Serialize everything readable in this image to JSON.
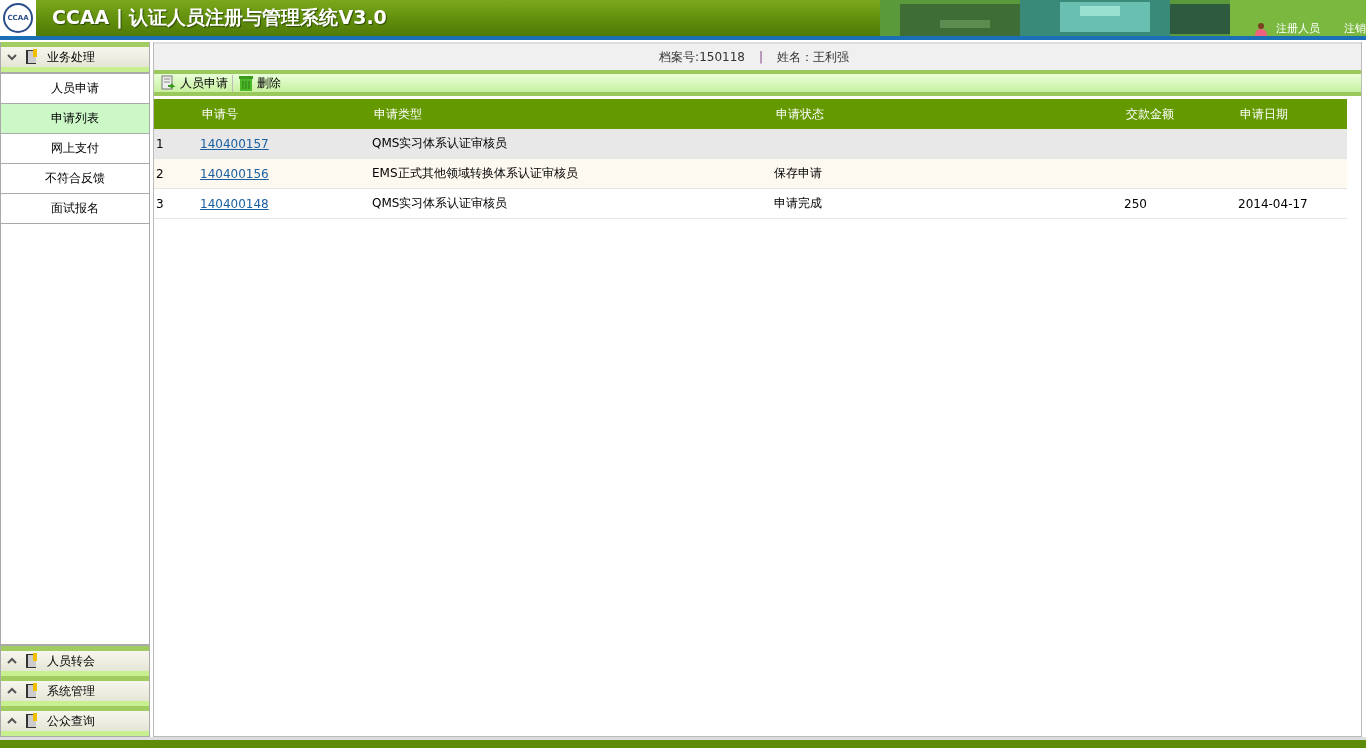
{
  "header": {
    "logo": "CCAA",
    "title": "CCAA | 认证人员注册与管理系统V3.0",
    "user_link": "注册人员",
    "logout_link": "注销"
  },
  "sidebar": {
    "sections": [
      {
        "label": "业务处理",
        "expanded": true,
        "items": [
          {
            "label": "人员申请",
            "selected": false
          },
          {
            "label": "申请列表",
            "selected": true
          },
          {
            "label": "网上支付",
            "selected": false
          },
          {
            "label": "不符合反馈",
            "selected": false
          },
          {
            "label": "面试报名",
            "selected": false
          }
        ]
      },
      {
        "label": "人员转会",
        "expanded": false
      },
      {
        "label": "系统管理",
        "expanded": false
      },
      {
        "label": "公众查询",
        "expanded": false
      }
    ]
  },
  "info_bar": {
    "file_no": "档案号:150118",
    "separator": "|",
    "name": "姓名：王利强"
  },
  "toolbar": [
    {
      "kind": "apply",
      "label": "人员申请"
    },
    {
      "kind": "delete",
      "label": "删除"
    }
  ],
  "table": {
    "columns": [
      "申请号",
      "申请类型",
      "申请状态",
      "交款金额",
      "申请日期"
    ],
    "rows": [
      {
        "index": "1",
        "number": "140400157",
        "type": "QMS实习体系认证审核员",
        "selected": true
      },
      {
        "index": "2",
        "number": "140400156",
        "type": "EMS正式其他领域转换体系认证审核员",
        "status": "保存申请",
        "selected": false
      },
      {
        "index": "3",
        "number": "140400148",
        "type": "QMS实习体系认证审核员",
        "status": "申请完成",
        "amount": "250",
        "date": "2014-04-17",
        "selected": false
      }
    ]
  }
}
